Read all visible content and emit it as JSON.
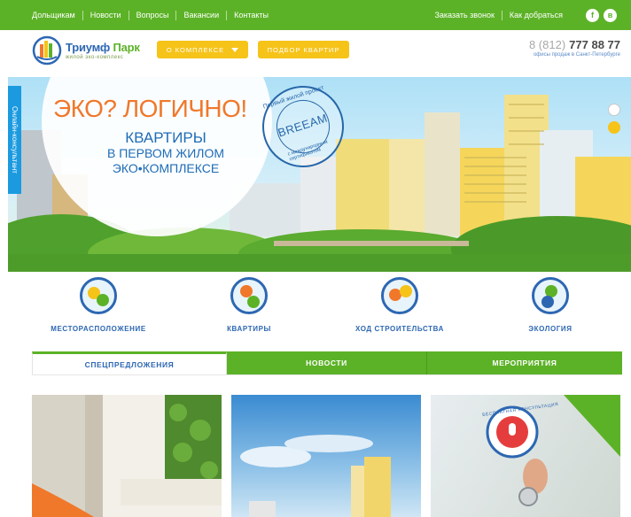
{
  "topbar": {
    "nav": [
      "Дольщикам",
      "Новости",
      "Вопросы",
      "Вакансии",
      "Контакты"
    ],
    "right": [
      "Заказать звонок",
      "Как добраться"
    ],
    "social": [
      {
        "icon": "facebook-icon",
        "glyph": "f"
      },
      {
        "icon": "vk-icon",
        "glyph": "в"
      }
    ]
  },
  "header": {
    "logo_name_part1": "Триумф",
    "logo_name_part2": "Парк",
    "logo_subtitle": "жилой эко-комплекс",
    "menu_about": "О КОМПЛЕКСЕ",
    "menu_apartments": "ПОДБОР КВАРТИР",
    "phone_code": "8 (812)",
    "phone_number": "777 88 77",
    "phone_note": "офисы продаж в Санкт-Петербурге"
  },
  "hero": {
    "slogan": "ЭКО? ЛОГИЧНО!",
    "line1": "КВАРТИРЫ",
    "line2": "В ПЕРВОМ ЖИЛОМ",
    "line3": "ЭКО•КОМПЛЕКСЕ",
    "stamp_top": "Первый жилой проект",
    "stamp_brand": "BREEAM",
    "stamp_bottom": "с международным сертификатом"
  },
  "consultant_label": "Онлайн-консультант",
  "features": [
    {
      "label": "МЕСТОРАСПОЛОЖЕНИЕ",
      "icon": "location-icon"
    },
    {
      "label": "КВАРТИРЫ",
      "icon": "key-icon"
    },
    {
      "label": "ХОД СТРОИТЕЛЬСТВА",
      "icon": "progress-clock-icon"
    },
    {
      "label": "ЭКОЛОГИЯ",
      "icon": "leaf-icon"
    }
  ],
  "tabs": [
    "СПЕЦПРЕДЛОЖЕНИЯ",
    "НОВОСТИ",
    "МЕРОПРИЯТИЯ"
  ],
  "cards": {
    "consultation_ribbon": "БЕСПЛАТНАЯ КОНСУЛЬТАЦИЯ"
  },
  "colors": {
    "brand_green": "#5cb227",
    "brand_blue": "#2d67b2",
    "accent_yellow": "#f6c319",
    "accent_orange": "#f0782b",
    "consultant_blue": "#1b9ae0"
  }
}
